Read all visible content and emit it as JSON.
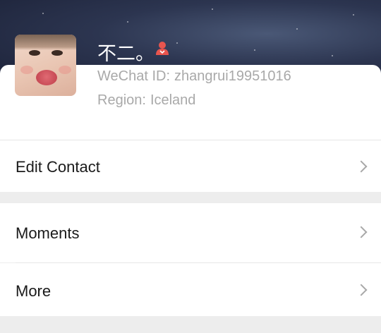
{
  "profile": {
    "nickname": "不二。",
    "wechat_id_label": "WeChat ID:",
    "wechat_id_value": "zhangrui19951016",
    "region_label": "Region:",
    "region_value": "Iceland",
    "badge_icon": "status-person-icon"
  },
  "menu": {
    "edit_contact": "Edit Contact",
    "moments": "Moments",
    "more": "More"
  },
  "colors": {
    "cover_dark": "#1c2238",
    "background": "#ededed",
    "label_gray": "#a9a9a9",
    "badge_red": "#e8554e"
  }
}
